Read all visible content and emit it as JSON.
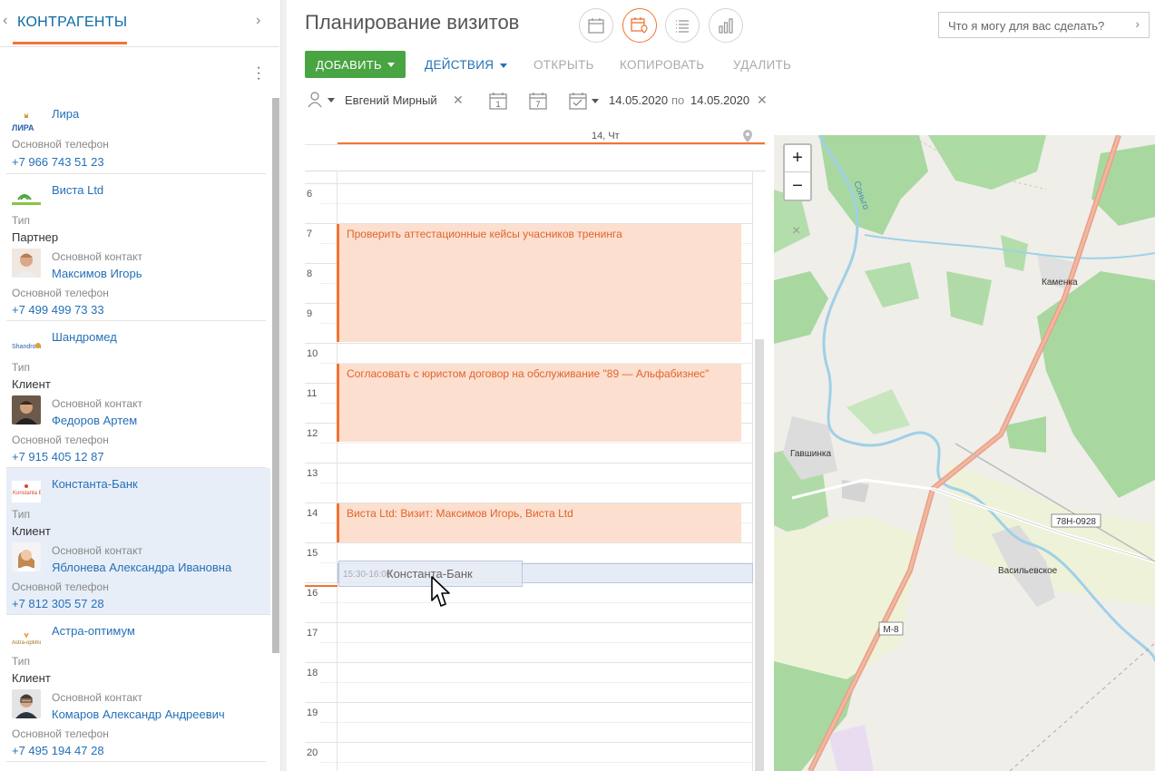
{
  "left_panel": {
    "title": "КОНТРАГЕНТЫ",
    "cards": [
      {
        "name": "Лира",
        "phone_label": "Основной телефон",
        "phone": "+7 966 743 51 23"
      },
      {
        "name": "Виста Ltd",
        "type_label": "Тип",
        "type": "Партнер",
        "contact_label": "Основной контакт",
        "contact": "Максимов Игорь",
        "phone_label": "Основной телефон",
        "phone": "+7 499 499 73 33"
      },
      {
        "name": "Шандромед",
        "type_label": "Тип",
        "type": "Клиент",
        "contact_label": "Основной контакт",
        "contact": "Федоров Артем",
        "phone_label": "Основной телефон",
        "phone": "+7 915 405 12 87"
      },
      {
        "name": "Константа-Банк",
        "type_label": "Тип",
        "type": "Клиент",
        "contact_label": "Основной контакт",
        "contact": "Яблонева Александра Ивановна",
        "phone_label": "Основной телефон",
        "phone": "+7 812 305 57 28"
      },
      {
        "name": "Астра-оптимум",
        "type_label": "Тип",
        "type": "Клиент",
        "contact_label": "Основной контакт",
        "contact": "Комаров Александр Андреевич",
        "phone_label": "Основной телефон",
        "phone": "+7 495 194 47 28"
      }
    ]
  },
  "header": {
    "title": "Планирование визитов",
    "help_placeholder": "Что я могу для вас сделать?"
  },
  "toolbar": {
    "add": "ДОБАВИТЬ",
    "actions": "ДЕЙСТВИЯ",
    "open": "ОТКРЫТЬ",
    "copy": "КОПИРОВАТЬ",
    "delete": "УДАЛИТЬ"
  },
  "filters": {
    "owner": "Евгений Мирный",
    "day_icon_num": "1",
    "week_icon_num": "7",
    "date_from": "14.05.2020",
    "date_sep": "по",
    "date_to": "14.05.2020"
  },
  "schedule": {
    "day_label": "14, Чт",
    "hours": [
      "6",
      "7",
      "8",
      "9",
      "10",
      "11",
      "12",
      "13",
      "14",
      "15",
      "16",
      "17",
      "18",
      "19",
      "20"
    ],
    "events": [
      {
        "title": "Проверить аттестационные кейсы учасников тренинга"
      },
      {
        "title": "Согласовать с юристом договор на обслуживание \"89 — Альфабизнес\""
      },
      {
        "title": "Виста Ltd: Визит: Максимов Игорь, Виста Ltd"
      }
    ],
    "drag": {
      "time": "15:30-16:00",
      "name": "Константа-Банк"
    }
  },
  "map": {
    "labels": {
      "river": "Соньго",
      "kamenka": "Каменка",
      "gavshinka": "Гавшинка",
      "vasilevskoe": "Васильевское",
      "road_m8": "М-8",
      "road_78n": "78Н-0928"
    },
    "zoom_in": "+",
    "zoom_out": "−",
    "close": "×"
  },
  "colors": {
    "accent": "#f27435",
    "primary_link": "#2470b8",
    "add_button": "#49a442",
    "event_bg": "#fcdfcf"
  }
}
